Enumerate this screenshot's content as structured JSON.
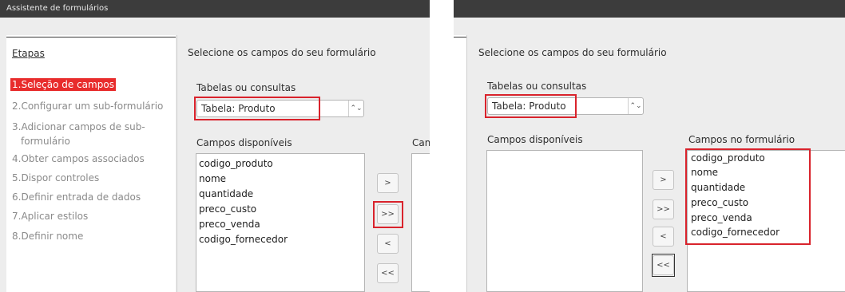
{
  "left": {
    "title": "Assistente de formulários",
    "steps_heading": "Etapas",
    "steps": [
      "1.Seleção de campos",
      "2.Configurar um sub-formulário",
      "3.Adicionar campos de sub-",
      "formulário",
      "4.Obter campos associados",
      "5.Dispor controles",
      "6.Definir entrada de dados",
      "7.Aplicar estilos",
      "8.Definir nome"
    ],
    "heading": "Selecione os campos do seu formulário",
    "tables_label": "Tabelas ou consultas",
    "table_value": "Tabela: Produto",
    "combo_arrow": "⌃⌄",
    "available_label": "Campos disponíveis",
    "available_items": [
      "codigo_produto",
      "nome",
      "quantidade",
      "preco_custo",
      "preco_venda",
      "codigo_fornecedor"
    ],
    "form_label_clipped": "Cam",
    "buttons": [
      ">",
      ">>",
      "<",
      "<<"
    ]
  },
  "right": {
    "heading": "Selecione os campos do seu formulário",
    "tables_label": "Tabelas ou consultas",
    "table_value": "Tabela: Produto",
    "combo_arrow": "⌃⌄",
    "available_label": "Campos disponíveis",
    "form_label": "Campos no formulário",
    "form_items": [
      "codigo_produto",
      "nome",
      "quantidade",
      "preco_custo",
      "preco_venda",
      "codigo_fornecedor"
    ],
    "buttons": [
      ">",
      ">>",
      "<",
      "<<"
    ]
  },
  "colors": {
    "highlight": "#d9232c",
    "active_step": "#e82c2c"
  }
}
